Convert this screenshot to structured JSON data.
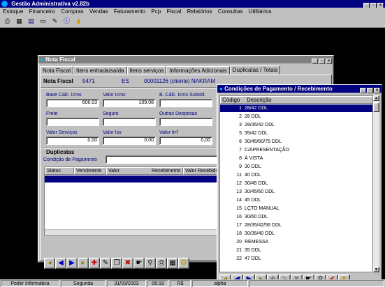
{
  "app": {
    "title": "Gestão Administrativa v2.82b"
  },
  "menu": [
    "Estoque",
    "Financeiro",
    "Compras",
    "Vendas",
    "Faturamento",
    "Pcp",
    "Fiscal",
    "Relatórios",
    "Consultas",
    "Utilitários"
  ],
  "toolbar": {
    "icons": [
      "printer-icon",
      "calculator-icon",
      "calendar-icon",
      "card-icon",
      "pen-icon",
      "info-icon",
      "exit-icon"
    ]
  },
  "nota_fiscal": {
    "window_title": "Nota Fiscal",
    "tabs": [
      "Nota Fiscal",
      "Itens entrada/saída",
      "Itens serviços",
      "Informações Adicionais",
      "Duplicatas / Totais"
    ],
    "selected_tab": 4,
    "header": {
      "label": "Nota Fiscal",
      "number": "5471",
      "uf": "ES",
      "client": "00001126  (cliente)  NAKRAM"
    },
    "fields": {
      "base_calc_icms": {
        "label": "Base Cálc. Icms",
        "value": "606,03"
      },
      "valor_icms": {
        "label": "Valor Icms",
        "value": "109,08"
      },
      "base_calc_subst": {
        "label": "B. Cálc. Icms Substit.",
        "value": ""
      },
      "frete": {
        "label": "Frete",
        "value": ""
      },
      "seguro": {
        "label": "Seguro",
        "value": ""
      },
      "outras_despesas": {
        "label": "Outras Despesas",
        "value": ""
      },
      "valor_servicos": {
        "label": "Valor Serviços",
        "value": "0,00"
      },
      "valor_iss": {
        "label": "Valor Iss",
        "value": "0,00"
      },
      "valor_irrf": {
        "label": "Valor Irrf",
        "value": "0,00"
      }
    },
    "duplicatas": {
      "title": "Duplicatas",
      "cond_label": "Condição de Pagamento",
      "cond_value": ""
    },
    "grid_headers": [
      "Status",
      "Vencimento",
      "Valor",
      "Recebimento",
      "Valor Recebido"
    ]
  },
  "condicoes": {
    "window_title": "Condições de Pagamento / Recebimento",
    "columns": [
      "Código",
      "Descrição"
    ],
    "rows": [
      {
        "code": "1",
        "desc": "28/42 DDL"
      },
      {
        "code": "2",
        "desc": "28 DDL"
      },
      {
        "code": "3",
        "desc": "28/35/42 DDL"
      },
      {
        "code": "5",
        "desc": "35/42 DDL"
      },
      {
        "code": "6",
        "desc": "30/45/60/75 DDL"
      },
      {
        "code": "7",
        "desc": "C/APRESENTAÇÃO"
      },
      {
        "code": "8",
        "desc": "À VISTA"
      },
      {
        "code": "9",
        "desc": "30 DDL"
      },
      {
        "code": "11",
        "desc": "40 DDL"
      },
      {
        "code": "12",
        "desc": "30/45 DDL"
      },
      {
        "code": "13",
        "desc": "30/45/60 DDL"
      },
      {
        "code": "14",
        "desc": "45 DDL"
      },
      {
        "code": "15",
        "desc": "LÇTO MANUAL"
      },
      {
        "code": "16",
        "desc": "30/60 DDL"
      },
      {
        "code": "17",
        "desc": "28/35/42/56 DDL"
      },
      {
        "code": "18",
        "desc": "30/35/40 DDL"
      },
      {
        "code": "20",
        "desc": "REMESSA"
      },
      {
        "code": "21",
        "desc": "35 DDL"
      },
      {
        "code": "22",
        "desc": "47 DDL"
      }
    ]
  },
  "status": [
    "Poder Informática",
    "Segunda",
    "31/03/2003",
    "06:19",
    "R$",
    "alpha"
  ],
  "colors": {
    "title_active": "#000080",
    "title_inactive": "#808080",
    "face": "#c0c0c0",
    "desktop": "#000000"
  }
}
